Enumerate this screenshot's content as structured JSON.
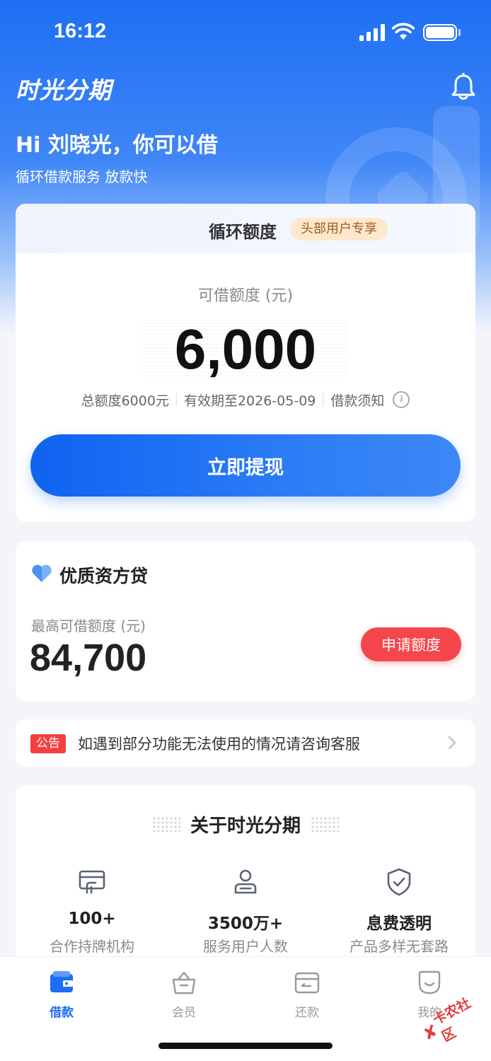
{
  "status_bar": {
    "time": "16:12"
  },
  "header": {
    "brand": "时光分期",
    "greeting": "Hi 刘晓光，你可以借",
    "subtitle": "循环借款服务 放款快"
  },
  "credit_card": {
    "title": "循环额度",
    "badge": "头部用户专享",
    "label": "可借额度 (元)",
    "amount": "6,000",
    "total": "总额度6000元",
    "validity": "有效期至2026-05-09",
    "notice_link": "借款须知",
    "button": "立即提现"
  },
  "loan_card": {
    "title": "优质资方贷",
    "label": "最高可借额度 (元)",
    "amount": "84,700",
    "button": "申请额度"
  },
  "notice": {
    "tag": "公告",
    "text": "如遇到部分功能无法使用的情况请咨询客服"
  },
  "about": {
    "title": "关于时光分期",
    "stats": [
      {
        "icon": "institution-icon",
        "value": "100+",
        "desc": "合作持牌机构"
      },
      {
        "icon": "user-icon",
        "value": "3500万+",
        "desc": "服务用户人数"
      },
      {
        "icon": "shield-check-icon",
        "value": "息费透明",
        "desc": "产品多样无套路"
      }
    ]
  },
  "tabs": [
    {
      "label": "借款",
      "icon": "wallet-icon",
      "active": true
    },
    {
      "label": "会员",
      "icon": "basket-icon",
      "active": false
    },
    {
      "label": "还款",
      "icon": "card-return-icon",
      "active": false
    },
    {
      "label": "我的",
      "icon": "smile-icon",
      "active": false
    }
  ],
  "watermark": "卡农社区",
  "colors": {
    "primary": "#1d6ef2",
    "danger": "#f53e3e",
    "badge_bg": "#fde8cd",
    "badge_text": "#a25a1a"
  }
}
